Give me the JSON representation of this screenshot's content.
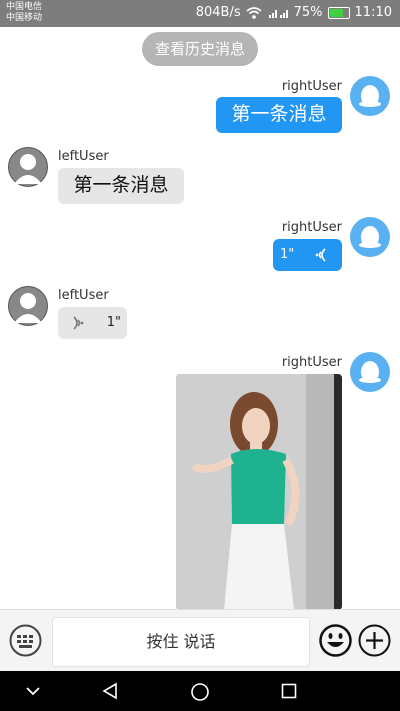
{
  "status_bar": {
    "carrier1": "中国电信",
    "carrier2": "中国移动",
    "speed": "804B/s",
    "signal_icons": "²⁶ᵢₗ ⁴⁶ᵢₗ",
    "battery": "75%",
    "time": "11:10"
  },
  "chat": {
    "history_button": "查看历史消息",
    "messages": [
      {
        "side": "right",
        "user": "rightUser",
        "type": "text",
        "text": "第一条消息"
      },
      {
        "side": "left",
        "user": "leftUser",
        "type": "text",
        "text": "第一条消息"
      },
      {
        "side": "right",
        "user": "rightUser",
        "type": "voice",
        "duration": "1\""
      },
      {
        "side": "left",
        "user": "leftUser",
        "type": "voice",
        "duration": "1\""
      },
      {
        "side": "right",
        "user": "rightUser",
        "type": "image"
      }
    ]
  },
  "input_bar": {
    "hold_to_talk": "按住 说话",
    "keyboard_icon": "keyboard-icon",
    "emoji_icon": "smiley-icon",
    "plus_icon": "plus-icon"
  },
  "nav_bar": {
    "back_icon": "chevron-down-icon",
    "triangle_icon": "back-triangle-icon",
    "home_icon": "home-circle-icon",
    "recent_icon": "recent-square-icon"
  }
}
